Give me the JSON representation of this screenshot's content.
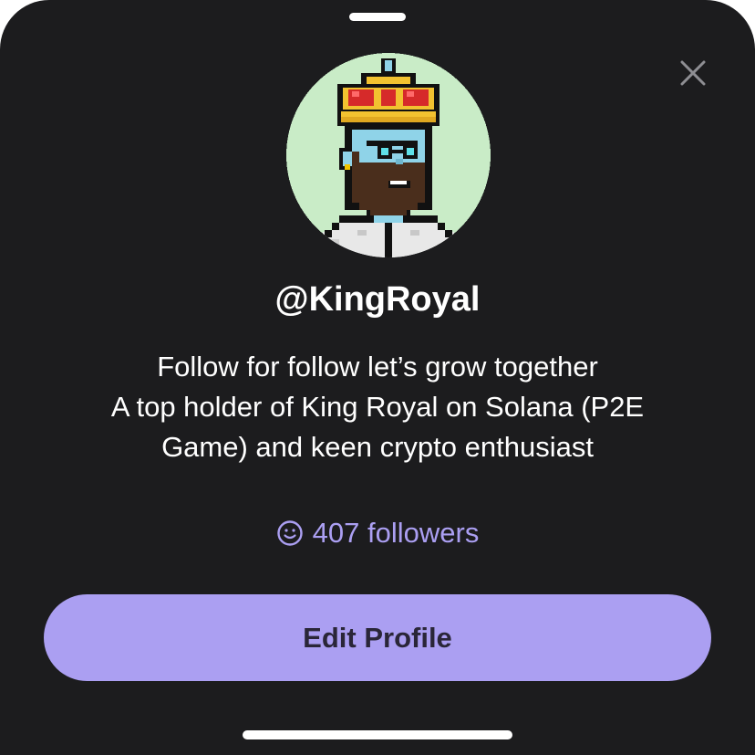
{
  "profile": {
    "username": "@KingRoyal",
    "bio_lines": [
      "Follow for follow let’s grow together",
      "A top holder of King Royal on Solana (P2E",
      "Game) and keen crypto enthusiast"
    ],
    "followers_text": "407 followers",
    "avatar_icon": "pixel-king-avatar-icon"
  },
  "actions": {
    "edit_profile_label": "Edit Profile",
    "close_icon": "close-icon"
  },
  "colors": {
    "background": "#1c1c1e",
    "accent": "#ab9ff2",
    "avatar_bg": "#c9ecc7",
    "text": "#ffffff"
  }
}
